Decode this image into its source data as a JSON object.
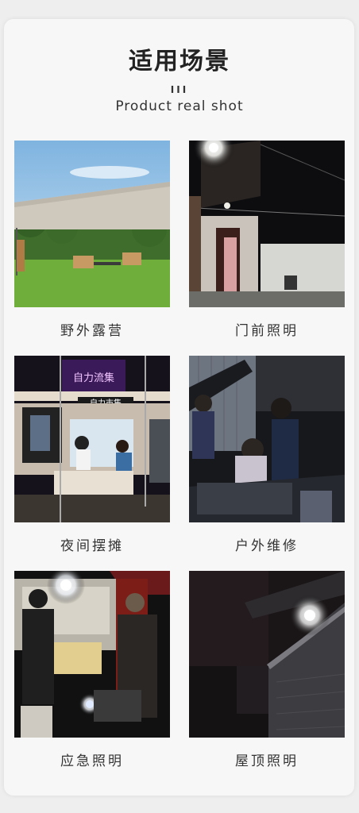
{
  "heading": {
    "title": "适用场景",
    "decoration": "III",
    "subtitle": "Product real shot"
  },
  "scenes": [
    {
      "label": "野外露营",
      "icon": "camping-photo"
    },
    {
      "label": "门前照明",
      "icon": "doorway-light-photo"
    },
    {
      "label": "夜间摆摊",
      "icon": "night-market-photo"
    },
    {
      "label": "户外维修",
      "icon": "outdoor-repair-photo"
    },
    {
      "label": "应急照明",
      "icon": "emergency-light-photo"
    },
    {
      "label": "屋顶照明",
      "icon": "roof-light-photo"
    }
  ],
  "signs": {
    "stall_sign": "自力流集",
    "stall_banner": "自力市集"
  }
}
